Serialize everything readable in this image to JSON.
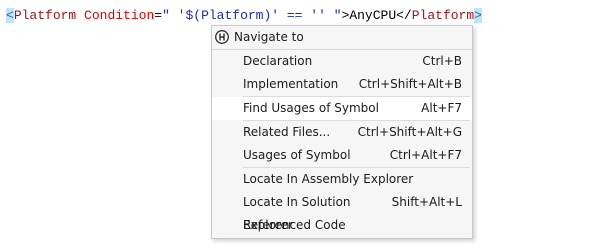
{
  "code": {
    "open_bracket": "<",
    "tag_name": "Platform",
    "attr_name": " Condition",
    "attr_eq": "=",
    "attr_value": "\" '$(Platform)' == '' \"",
    "close_bracket": ">",
    "inner_text": "AnyCPU",
    "end_tag_open": "</",
    "end_tag_name": "Platform",
    "end_tag_close": ">"
  },
  "menu": {
    "title": "Navigate to",
    "icon": "navigate-icon",
    "items": [
      {
        "label": "Declaration",
        "shortcut": "Ctrl+B"
      },
      {
        "label": "Implementation",
        "shortcut": "Ctrl+Shift+Alt+B"
      },
      {
        "label": "Find Usages of Symbol",
        "shortcut": "Alt+F7",
        "selected": true
      },
      {
        "label": "Related Files...",
        "shortcut": "Ctrl+Shift+Alt+G"
      },
      {
        "label": "Usages of Symbol",
        "shortcut": "Ctrl+Alt+F7"
      },
      {
        "label": "Locate In Assembly Explorer",
        "shortcut": ""
      },
      {
        "label": "Locate In Solution Explorer",
        "shortcut": "Shift+Alt+L"
      },
      {
        "label": "Referenced Code",
        "shortcut": ""
      }
    ]
  },
  "colors": {
    "bracket_highlight": "#bde4f7",
    "menu_background": "#f6f6f6",
    "selected_row": "#ffffff"
  }
}
